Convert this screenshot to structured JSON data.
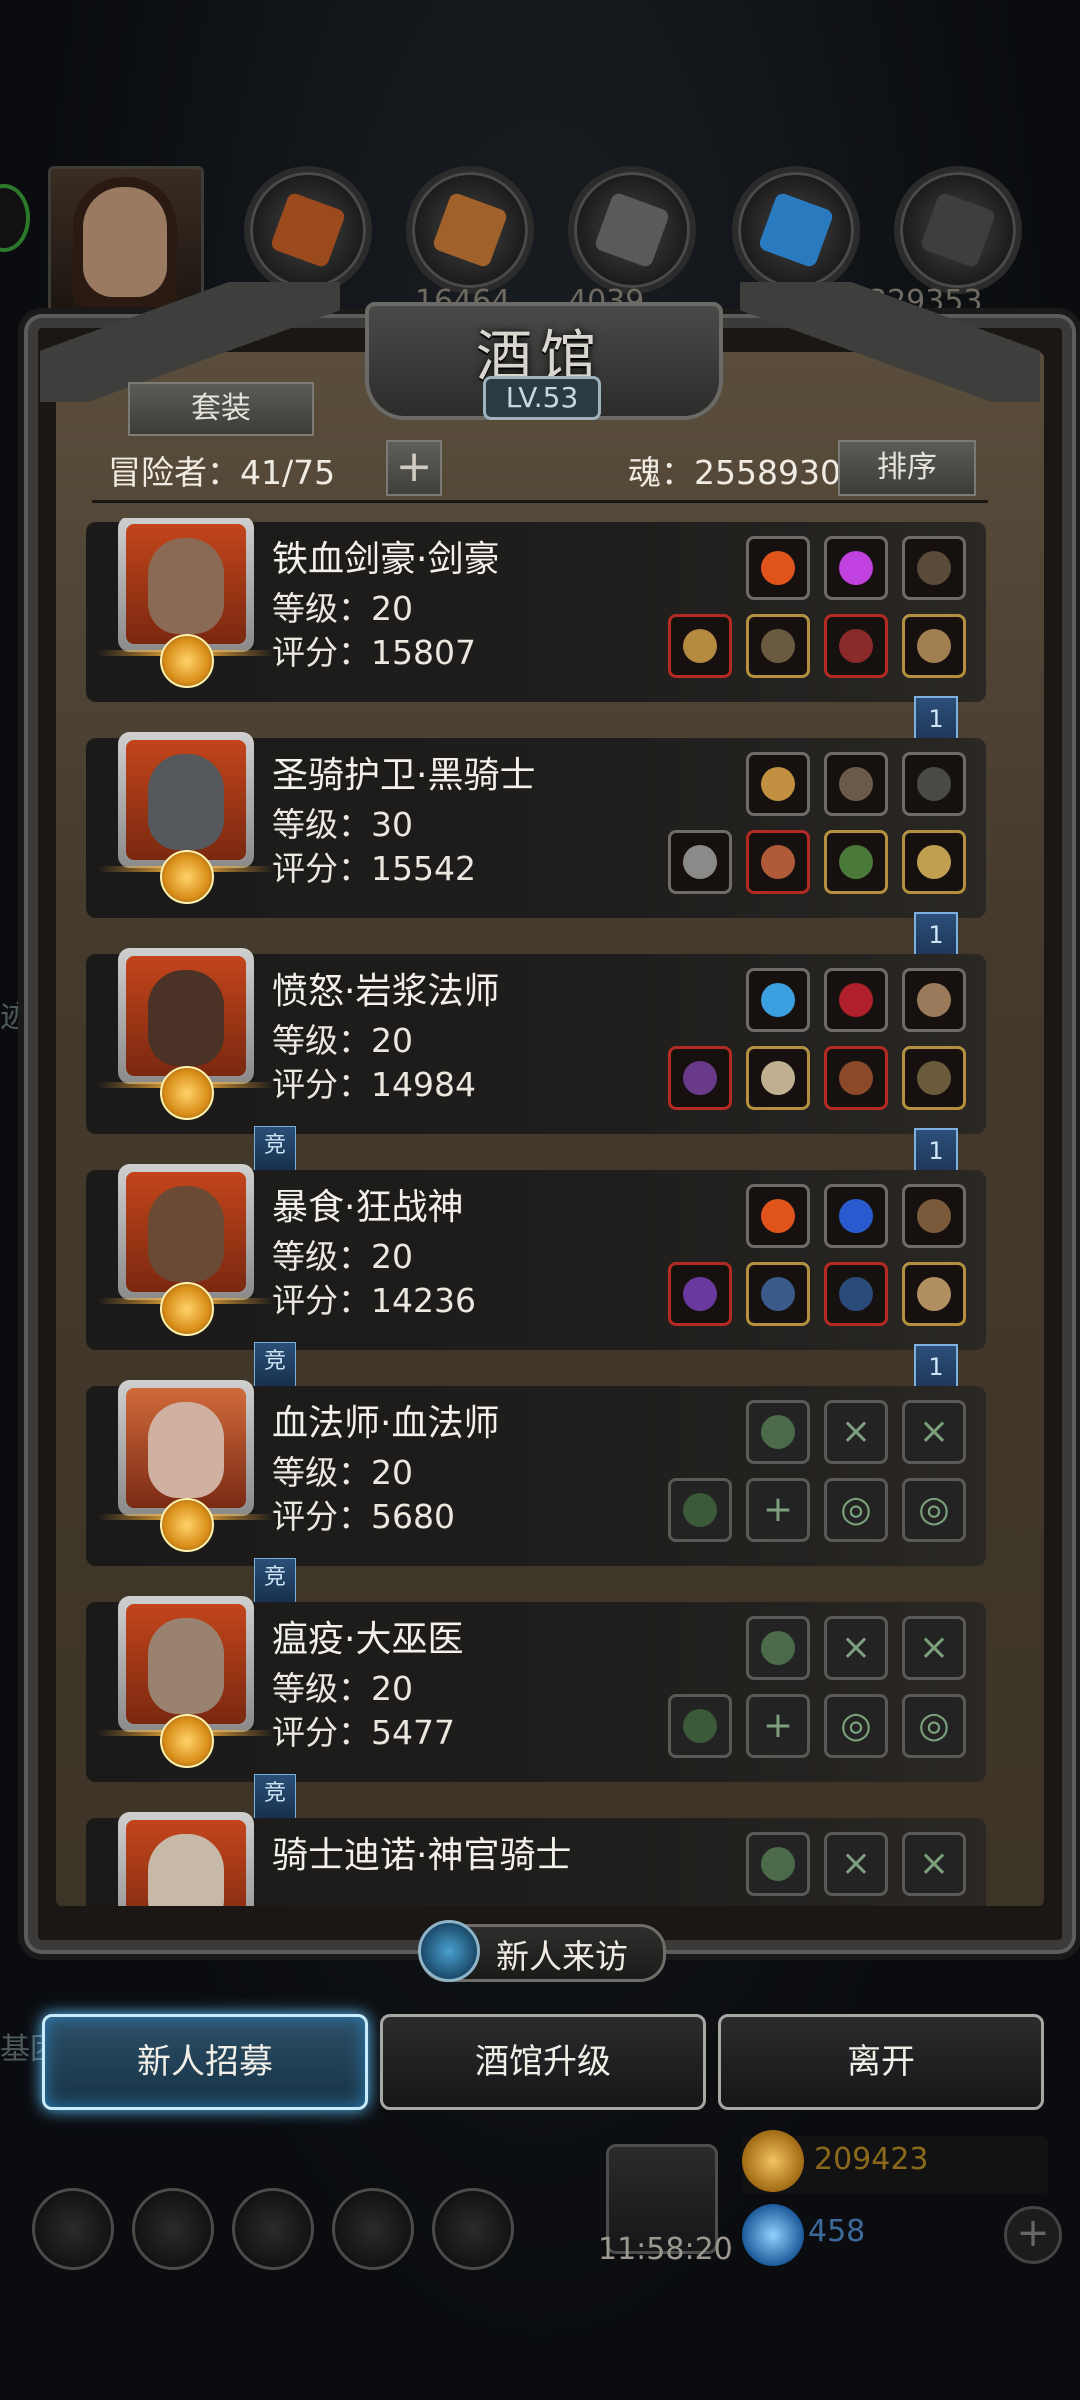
{
  "header": {
    "title": "酒馆",
    "level": "LV.53",
    "suit_button": "套装",
    "adventurers": "冒险者：41/75",
    "add_symbol": "+",
    "soul": "魂：2558930",
    "sort_button": "排序"
  },
  "top_resources": [
    "16464",
    "4039",
    "329353"
  ],
  "background": {
    "left_ghost_1": "迹",
    "left_ghost_2": "基团"
  },
  "heroes": [
    {
      "name": "铁血剑豪·剑豪",
      "level": "等级：20",
      "score": "评分：15807",
      "ribbon": "1",
      "comp": ""
    },
    {
      "name": "圣骑护卫·黑骑士",
      "level": "等级：30",
      "score": "评分：15542",
      "ribbon": "1",
      "comp": ""
    },
    {
      "name": "愤怒·岩浆法师",
      "level": "等级：20",
      "score": "评分：14984",
      "ribbon": "1",
      "comp": "竞"
    },
    {
      "name": "暴食·狂战神",
      "level": "等级：20",
      "score": "评分：14236",
      "ribbon": "1",
      "comp": "竞"
    },
    {
      "name": "血法师·血法师",
      "level": "等级：20",
      "score": "评分：5680",
      "ribbon": "",
      "comp": "竞"
    },
    {
      "name": "瘟疫·大巫医",
      "level": "等级：20",
      "score": "评分：5477",
      "ribbon": "",
      "comp": "竞"
    },
    {
      "name": "骑士迪诺·神官骑士",
      "level": "",
      "score": "",
      "ribbon": "",
      "comp": ""
    }
  ],
  "visit": "新人来访",
  "buttons": {
    "recruit": "新人招募",
    "upgrade": "酒馆升级",
    "leave": "离开"
  },
  "hud": {
    "timer": "11:58:20",
    "coins": "209423",
    "gems": "458"
  }
}
